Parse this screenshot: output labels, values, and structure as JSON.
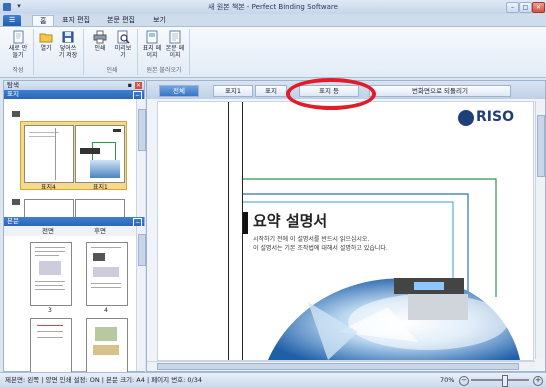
{
  "window": {
    "title": "새 원본 책본 - Perfect Binding Software",
    "minimize": "–",
    "maximize": "□",
    "close": "✕"
  },
  "ribbon_tabs": [
    "",
    "홈",
    "표지 편집",
    "본문 편집",
    "보기"
  ],
  "ribbon": {
    "groups": [
      {
        "name": "작성",
        "buttons": [
          {
            "label": "새로 만들기",
            "icon": "new-file-icon"
          }
        ]
      },
      {
        "name": "",
        "buttons": [
          {
            "label": "열기",
            "icon": "open-folder-icon"
          },
          {
            "label": "덮어쓰기 저장",
            "icon": "save-disk-icon"
          }
        ]
      },
      {
        "name": "인쇄",
        "buttons": [
          {
            "label": "인쇄",
            "icon": "printer-icon"
          },
          {
            "label": "미리보기",
            "icon": "preview-icon"
          }
        ]
      },
      {
        "name": "원본 불러오기",
        "buttons": [
          {
            "label": "표지 페이지",
            "icon": "cover-page-icon"
          },
          {
            "label": "본문 페이지",
            "icon": "body-page-icon"
          }
        ]
      }
    ]
  },
  "nav_panel": {
    "title": "탐색",
    "cover_header": "표지",
    "cover_labels": [
      "표지4",
      "표지1"
    ],
    "body_header": "본문",
    "body_columns": [
      "전면",
      "후면"
    ],
    "page_numbers": [
      "3",
      "4"
    ]
  },
  "preview_tabs": [
    "전체",
    "표지1",
    "표지",
    "표지 등",
    "번화면으로 되돌리기"
  ],
  "document": {
    "logo": "RISO",
    "heading": "요약 설명서",
    "line1": "시작하기 전에 이 설명서를 반드시 읽으십시오.",
    "line2": "이 설명서는 기본 조작법에 대해서 설명하고 있습니다."
  },
  "statusbar": {
    "text": "제본면: 왼쪽  |  양면 인쇄 설정: ON  |  본문 크기: A4  |  페이지 번호: 0/34",
    "zoom": "70%",
    "zoom_out": "−",
    "zoom_in": "+",
    "zoom_fraction": 0.6
  }
}
